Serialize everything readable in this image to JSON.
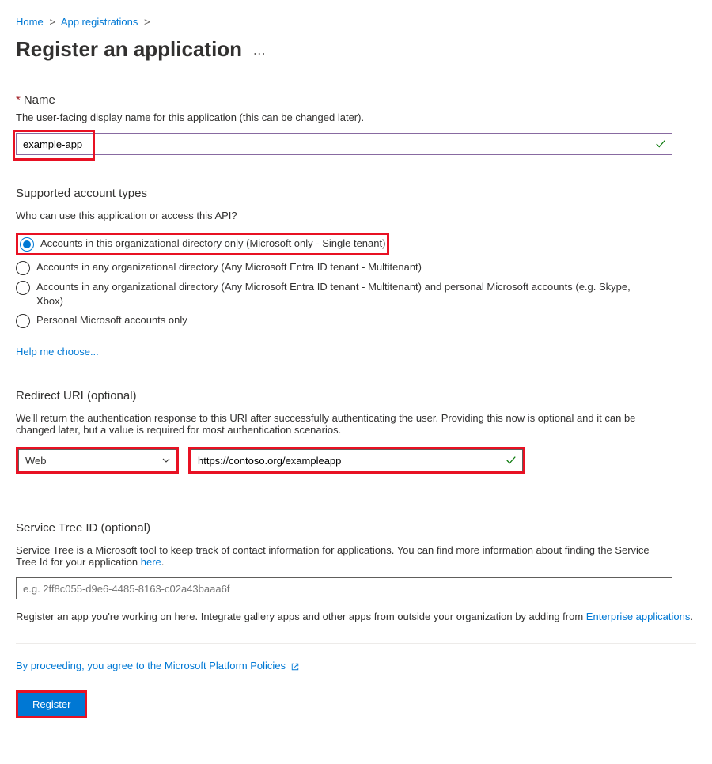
{
  "breadcrumb": {
    "home": "Home",
    "appReg": "App registrations"
  },
  "page": {
    "title": "Register an application"
  },
  "name": {
    "label": "Name",
    "desc": "The user-facing display name for this application (this can be changed later).",
    "value": "example-app"
  },
  "accountTypes": {
    "title": "Supported account types",
    "question": "Who can use this application or access this API?",
    "options": [
      "Accounts in this organizational directory only (Microsoft only - Single tenant)",
      "Accounts in any organizational directory (Any Microsoft Entra ID tenant - Multitenant)",
      "Accounts in any organizational directory (Any Microsoft Entra ID tenant - Multitenant) and personal Microsoft accounts (e.g. Skype, Xbox)",
      "Personal Microsoft accounts only"
    ],
    "helpLink": "Help me choose..."
  },
  "redirect": {
    "title": "Redirect URI (optional)",
    "desc": "We'll return the authentication response to this URI after successfully authenticating the user. Providing this now is optional and it can be changed later, but a value is required for most authentication scenarios.",
    "platform": "Web",
    "uri": "https://contoso.org/exampleapp"
  },
  "serviceTree": {
    "title": "Service Tree ID (optional)",
    "descPrefix": "Service Tree is a Microsoft tool to keep track of contact information for applications. You can find more information about finding the Service Tree Id for your application ",
    "hereLink": "here",
    "placeholder": "e.g. 2ff8c055-d9e6-4485-8163-c02a43baaa6f"
  },
  "gallery": {
    "prefix": "Register an app you're working on here. Integrate gallery apps and other apps from outside your organization by adding from ",
    "link": "Enterprise applications"
  },
  "policy": {
    "text": "By proceeding, you agree to the Microsoft Platform Policies"
  },
  "register": {
    "label": "Register"
  }
}
